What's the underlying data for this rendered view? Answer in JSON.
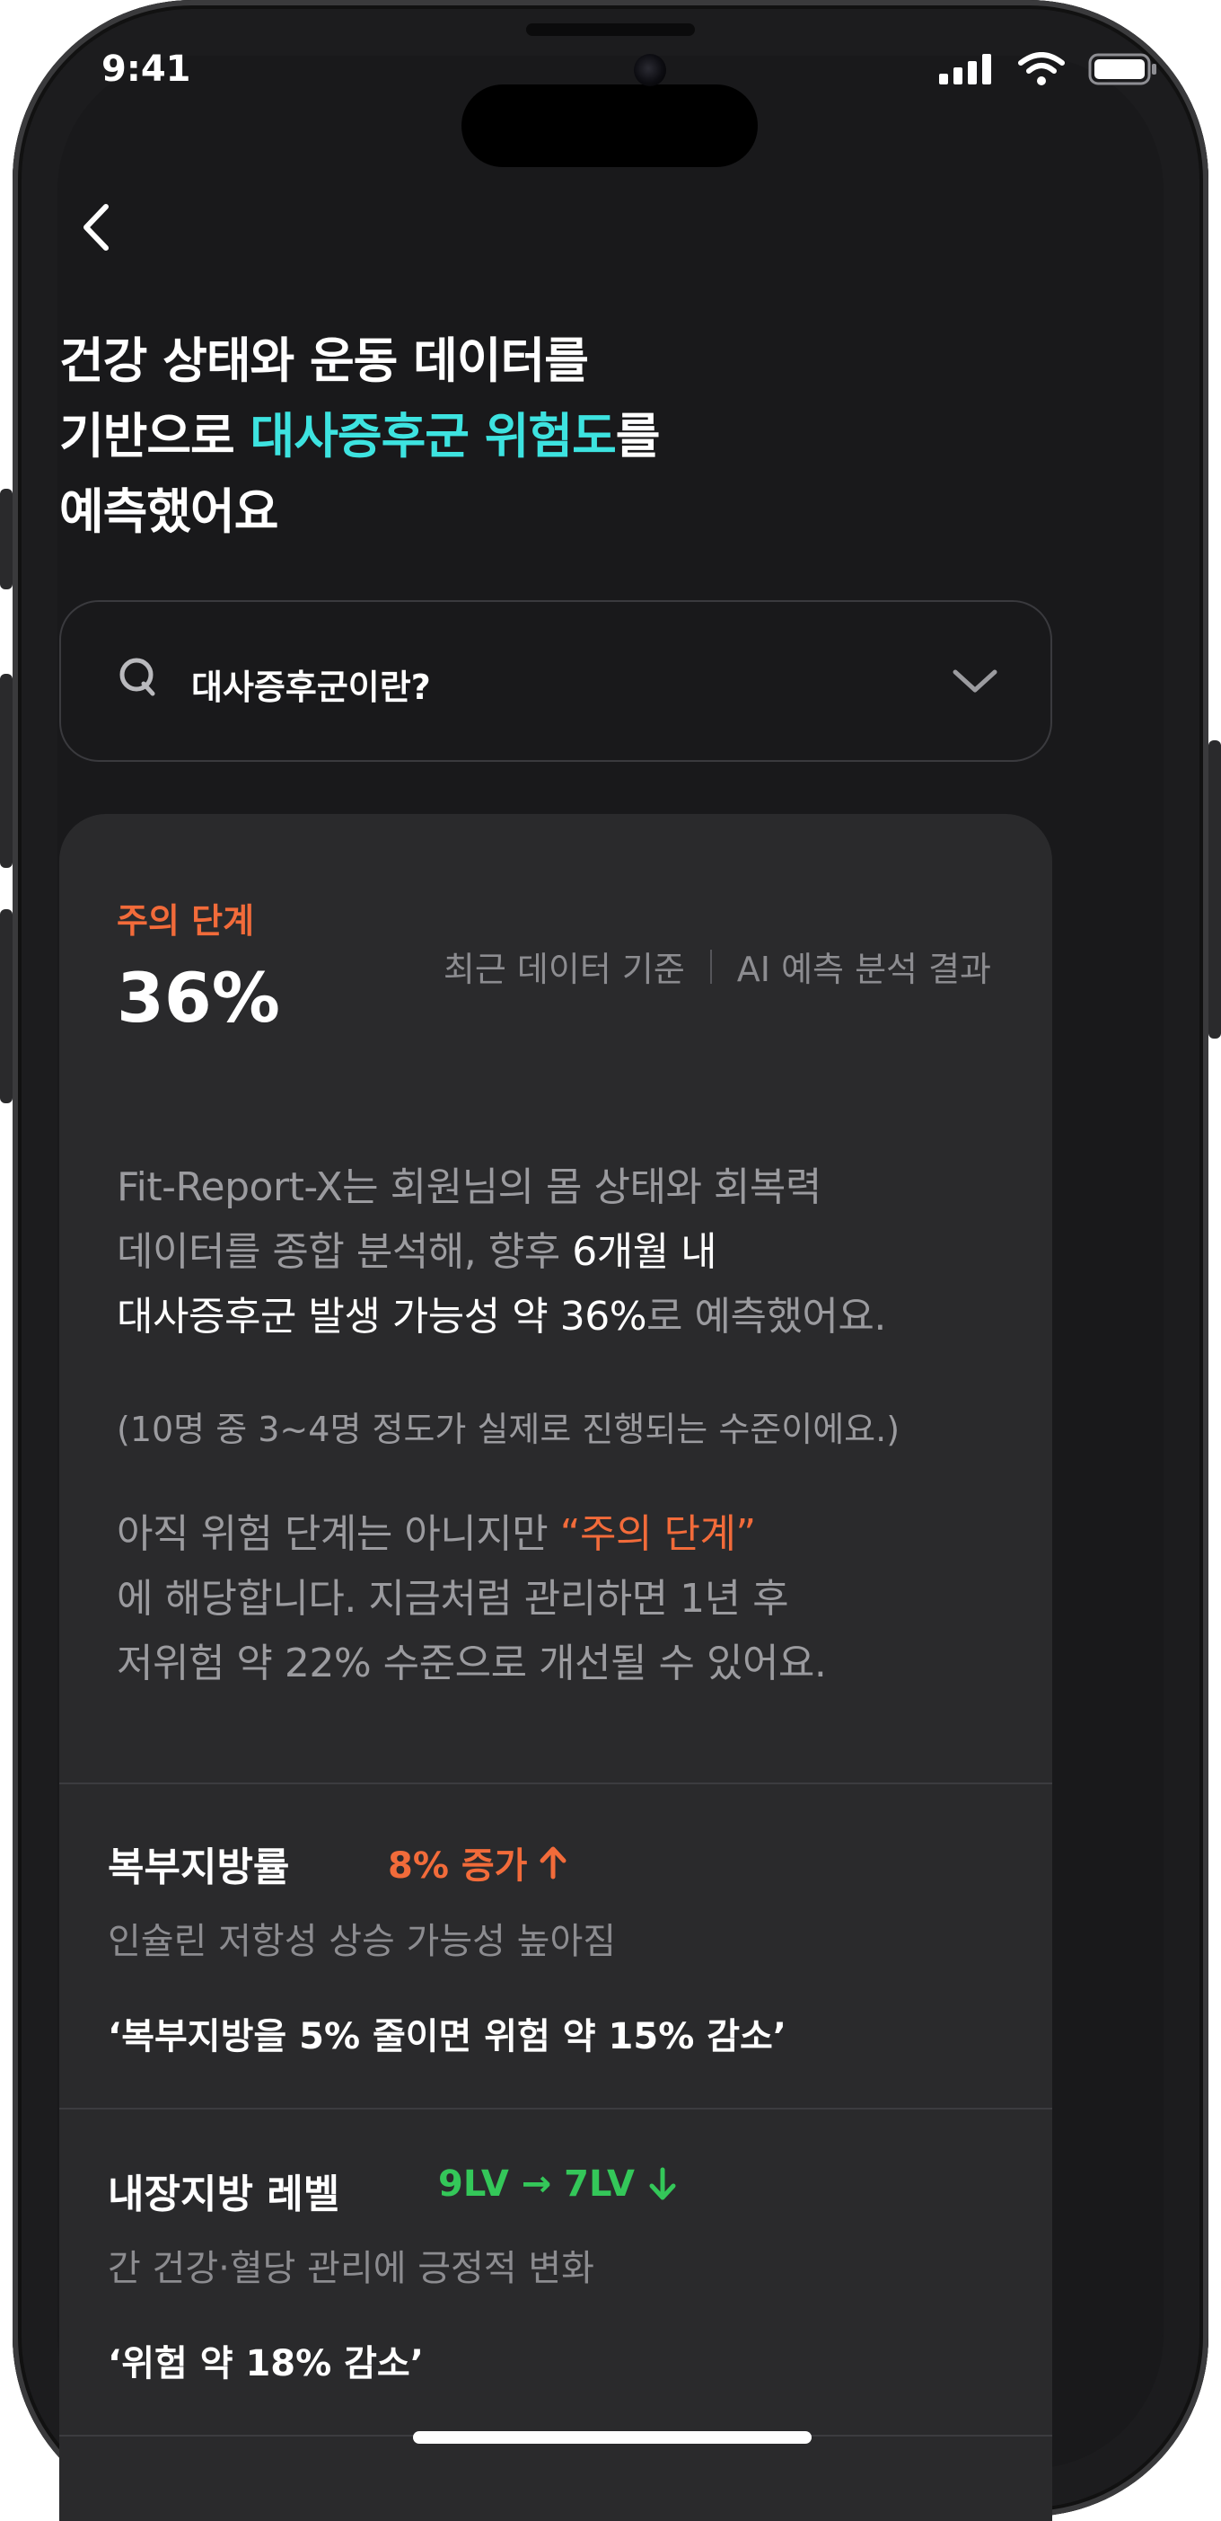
{
  "status_bar": {
    "time": "9:41"
  },
  "header": {
    "line1": "건강 상태와 운동 데이터를",
    "line2_before": "기반으로 ",
    "line2_accent": "대사증후군 위험도",
    "line2_after": "를",
    "line3": "예측했어요"
  },
  "faq": {
    "question": "대사증후군이란?"
  },
  "result": {
    "stage_label": "주의 단계",
    "percent": "36%",
    "basis": "최근 데이터 기준",
    "source": "AI 예측 분석 결과",
    "para1_line1": "Fit-Report-X는 회원님의 몸 상태와 회복력",
    "para1_line2_a": "데이터를 종합 분석해, 향후 ",
    "para1_line2_b": "6개월 내",
    "para1_line3_a": "대사증후군 발생 가능성 약 36%",
    "para1_line3_b": "로 예측했어요.",
    "note": "(10명 중 3~4명 정도가 실제로 진행되는 수준이에요.)",
    "para2_line1_a": "아직 위험 단계는 아니지만  ",
    "para2_line1_b": "“주의 단계”",
    "para2_line2": "에 해당합니다. 지금처럼 관리하면 1년 후",
    "para2_line3": "저위험 약 22% 수준으로 개선될 수 있어요."
  },
  "metrics": [
    {
      "title": "복부지방률",
      "delta": "8% 증가",
      "sub": "인슐린 저항성 상승 가능성 높아짐",
      "quote": "‘복부지방을 5% 줄이면 위험 약 15% 감소’",
      "color": "#f26b3a"
    },
    {
      "title": "내장지방 레벨",
      "delta": "9LV → 7LV",
      "sub": "간 건강·혈당 관리에 긍정적 변화",
      "quote": "‘위험 약 18% 감소’",
      "color": "#34c759"
    }
  ],
  "icons": [
    "back-arrow-icon",
    "q-icon",
    "chevron-down-icon",
    "arrow-up-icon",
    "arrow-down-icon",
    "signal-icon",
    "wifi-icon",
    "battery-icon"
  ]
}
